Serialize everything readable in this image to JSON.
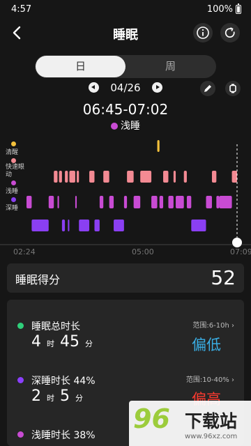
{
  "status_bar": {
    "time": "4:57",
    "battery": "100%"
  },
  "header": {
    "title": "睡眠"
  },
  "tabs": {
    "day": "日",
    "week": "周"
  },
  "date": "04/26",
  "time_range": "06:45-07:02",
  "selected_stage": "浅睡",
  "legend": {
    "awake": "清醒",
    "rem": "快速眼动",
    "light": "浅睡",
    "deep": "深睡"
  },
  "chart_data": {
    "type": "step",
    "stages": [
      "深睡",
      "浅睡",
      "快速眼动",
      "清醒"
    ],
    "x_ticks": [
      "02:24",
      "05:00",
      "07:09"
    ],
    "x_range": [
      "02:24",
      "07:09"
    ],
    "cursor_time": "07:09",
    "segments": [
      [
        "02:24",
        "02:31",
        "浅睡"
      ],
      [
        "02:31",
        "02:54",
        "深睡"
      ],
      [
        "02:54",
        "03:01",
        "浅睡"
      ],
      [
        "03:01",
        "03:06",
        "快速眼动"
      ],
      [
        "03:06",
        "03:08",
        "浅睡"
      ],
      [
        "03:08",
        "03:12",
        "快速眼动"
      ],
      [
        "03:12",
        "03:16",
        "深睡"
      ],
      [
        "03:16",
        "03:20",
        "快速眼动"
      ],
      [
        "03:20",
        "03:22",
        "深睡"
      ],
      [
        "03:22",
        "03:30",
        "快速眼动"
      ],
      [
        "03:30",
        "03:32",
        "浅睡"
      ],
      [
        "03:32",
        "03:35",
        "快速眼动"
      ],
      [
        "03:35",
        "03:49",
        "深睡"
      ],
      [
        "03:49",
        "03:56",
        "快速眼动"
      ],
      [
        "03:56",
        "04:03",
        "深睡"
      ],
      [
        "04:03",
        "04:08",
        "浅睡"
      ],
      [
        "04:08",
        "04:16",
        "快速眼动"
      ],
      [
        "04:16",
        "04:22",
        "浅睡"
      ],
      [
        "04:22",
        "04:36",
        "深睡"
      ],
      [
        "04:36",
        "04:40",
        "浅睡"
      ],
      [
        "04:40",
        "04:49",
        "快速眼动"
      ],
      [
        "04:49",
        "04:58",
        "浅睡"
      ],
      [
        "04:58",
        "05:13",
        "快速眼动"
      ],
      [
        "05:13",
        "05:21",
        "浅睡"
      ],
      [
        "05:21",
        "05:24",
        "清醒"
      ],
      [
        "05:24",
        "05:29",
        "浅睡"
      ],
      [
        "05:29",
        "05:36",
        "快速眼动"
      ],
      [
        "05:36",
        "05:43",
        "浅睡"
      ],
      [
        "05:43",
        "05:46",
        "快速眼动"
      ],
      [
        "05:46",
        "05:57",
        "浅睡"
      ],
      [
        "05:57",
        "06:01",
        "快速眼动"
      ],
      [
        "06:01",
        "06:07",
        "浅睡"
      ],
      [
        "06:07",
        "06:27",
        "深睡"
      ],
      [
        "06:27",
        "06:35",
        "浅睡"
      ],
      [
        "06:35",
        "06:41",
        "快速眼动"
      ],
      [
        "06:41",
        "06:45",
        "浅睡"
      ],
      [
        "06:45",
        "07:02",
        "浅睡"
      ],
      [
        "07:02",
        "07:09",
        "快速眼动"
      ]
    ]
  },
  "score": {
    "label": "睡眠得分",
    "value": "52"
  },
  "details": [
    {
      "name": "睡眠总时长",
      "range": "范围:6-10h",
      "hours": "4",
      "hours_unit": "时",
      "minutes": "45",
      "minutes_unit": "分",
      "status": "偏低",
      "status_color": "#3aaee5",
      "color": "#2fcf7a"
    },
    {
      "name": "深睡时长 44%",
      "range": "范围:10-40%",
      "hours": "2",
      "hours_unit": "时",
      "minutes": "5",
      "minutes_unit": "分",
      "status": "偏高",
      "status_color": "#ff3b30",
      "color": "#8b3fff"
    },
    {
      "name": "浅睡时长 38%",
      "range": "",
      "hours": "",
      "hours_unit": "",
      "minutes": "",
      "minutes_unit": "",
      "status": "",
      "status_color": "#ffffff",
      "color": "#c84bd3"
    }
  ],
  "colors": {
    "deep": "#8a3ff2",
    "light": "#c84bd3",
    "rem": "#f38a93",
    "awake": "#f3c03b"
  },
  "watermark": {
    "logo": "96",
    "text": "下载站",
    "url": "www.96xz.com"
  }
}
